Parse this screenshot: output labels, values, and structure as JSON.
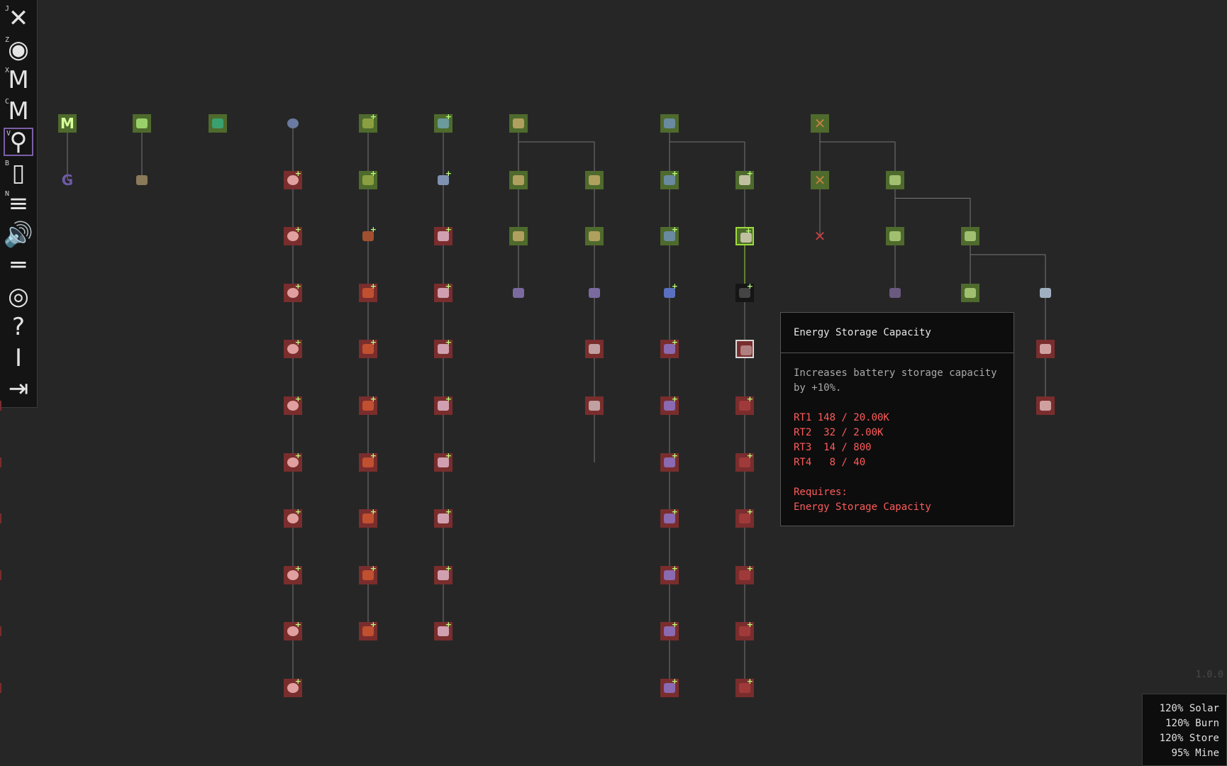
{
  "sidebar": {
    "buttons": [
      {
        "key": "J",
        "name": "tech-tree-button",
        "glyph": "✕",
        "color": "#e4e4e4"
      },
      {
        "key": "Z",
        "name": "planet-button",
        "glyph": "◉",
        "color": "#e4e4e4"
      },
      {
        "key": "X",
        "name": "map-x-button",
        "glyph": "M",
        "color": "#e4e4e4"
      },
      {
        "key": "C",
        "name": "map-c-button",
        "glyph": "M",
        "color": "#e4e4e4"
      },
      {
        "key": "V",
        "name": "search-button",
        "glyph": "⚲",
        "color": "#e4e4e4"
      },
      {
        "key": "B",
        "name": "build-button",
        "glyph": "▯",
        "color": "#e4e4e4"
      },
      {
        "key": "N",
        "name": "list-button",
        "glyph": "≡",
        "color": "#e4e4e4"
      },
      {
        "key": "",
        "name": "sound-button",
        "glyph": "🔊",
        "color": "#e4e4e4"
      },
      {
        "key": "",
        "name": "menu-button",
        "glyph": "═",
        "color": "#e4e4e4"
      },
      {
        "key": "",
        "name": "view-button",
        "glyph": "◎",
        "color": "#e4e4e4"
      },
      {
        "key": "",
        "name": "help-button",
        "glyph": "?",
        "color": "#e4e4e4"
      },
      {
        "key": "",
        "name": "info-button",
        "glyph": "I",
        "color": "#e4e4e4"
      },
      {
        "key": "",
        "name": "exit-button",
        "glyph": "⇥",
        "color": "#e4e4e4"
      }
    ],
    "active_index": 4
  },
  "tooltip": {
    "title": "Energy Storage Capacity",
    "description": "Increases battery storage capacity by +10%.",
    "costs": [
      "RT1 148 / 20.00K",
      "RT2  32 / 2.00K",
      "RT3  14 / 800",
      "RT4   8 / 40"
    ],
    "requires_label": "Requires:",
    "requires_item": "Energy Storage Capacity"
  },
  "version": "1.0.0",
  "stats": [
    "120% Solar",
    "120% Burn",
    "120% Store",
    " 95% Mine"
  ],
  "colors": {
    "unlocked": "#4e6a2c",
    "locked": "#7a2d2d",
    "selected_border": "#9ddb3a",
    "cost_text": "#ff5b5b"
  }
}
